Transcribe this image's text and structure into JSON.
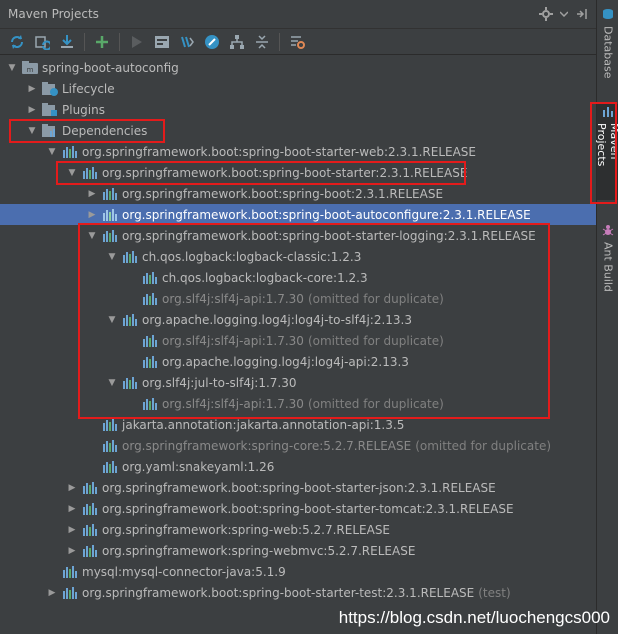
{
  "window": {
    "title": "Maven Projects"
  },
  "side_tabs": [
    {
      "label": "Database",
      "icon": "database-icon"
    },
    {
      "label": "Maven Projects",
      "icon": "maven-icon"
    },
    {
      "label": "Ant Build",
      "icon": "ant-icon"
    }
  ],
  "toolbar": {
    "buttons": [
      "reimport-icon",
      "generate-sources-icon",
      "download-icon",
      "add-icon",
      "run-icon",
      "execute-goal-icon",
      "toggle-offline-icon",
      "skip-tests-icon",
      "show-dependencies-icon",
      "collapse-all-icon",
      "settings-icon"
    ]
  },
  "tree": {
    "root": {
      "label": "spring-boot-autoconfig"
    },
    "lifecycle": {
      "label": "Lifecycle"
    },
    "plugins": {
      "label": "Plugins"
    },
    "dependencies": {
      "label": "Dependencies"
    },
    "starter_web": {
      "label": "org.springframework.boot:spring-boot-starter-web:2.3.1.RELEASE"
    },
    "starter": {
      "label": "org.springframework.boot:spring-boot-starter:2.3.1.RELEASE"
    },
    "spring_boot": {
      "label": "org.springframework.boot:spring-boot:2.3.1.RELEASE"
    },
    "autoconfigure": {
      "label": "org.springframework.boot:spring-boot-autoconfigure:2.3.1.RELEASE"
    },
    "starter_logging": {
      "label": "org.springframework.boot:spring-boot-starter-logging:2.3.1.RELEASE"
    },
    "logback_classic": {
      "label": "ch.qos.logback:logback-classic:1.2.3"
    },
    "logback_core": {
      "label": "ch.qos.logback:logback-core:1.2.3"
    },
    "slf4j_api_1": {
      "label": "org.slf4j:slf4j-api:1.7.30",
      "suffix": "(omitted for duplicate)"
    },
    "log4j_to_slf4j": {
      "label": "org.apache.logging.log4j:log4j-to-slf4j:2.13.3"
    },
    "slf4j_api_2": {
      "label": "org.slf4j:slf4j-api:1.7.30",
      "suffix": "(omitted for duplicate)"
    },
    "log4j_api": {
      "label": "org.apache.logging.log4j:log4j-api:2.13.3"
    },
    "jul_to_slf4j": {
      "label": "org.slf4j:jul-to-slf4j:1.7.30"
    },
    "slf4j_api_3": {
      "label": "org.slf4j:slf4j-api:1.7.30",
      "suffix": "(omitted for duplicate)"
    },
    "jakarta_annotation": {
      "label": "jakarta.annotation:jakarta.annotation-api:1.3.5"
    },
    "spring_core": {
      "label": "org.springframework:spring-core:5.2.7.RELEASE",
      "suffix": "(omitted for duplicate)"
    },
    "snakeyaml": {
      "label": "org.yaml:snakeyaml:1.26"
    },
    "starter_json": {
      "label": "org.springframework.boot:spring-boot-starter-json:2.3.1.RELEASE"
    },
    "starter_tomcat": {
      "label": "org.springframework.boot:spring-boot-starter-tomcat:2.3.1.RELEASE"
    },
    "spring_web": {
      "label": "org.springframework:spring-web:5.2.7.RELEASE"
    },
    "spring_webmvc": {
      "label": "org.springframework:spring-webmvc:5.2.7.RELEASE"
    },
    "mysql_connector": {
      "label": "mysql:mysql-connector-java:5.1.9"
    },
    "starter_test": {
      "label": "org.springframework.boot:spring-boot-starter-test:2.3.1.RELEASE",
      "suffix": "(test)"
    }
  },
  "watermark": "https://blog.csdn.net/luochengcs000",
  "colors": {
    "background": "#3c3f41",
    "selection": "#4b6eaf",
    "annotation": "#e31b1b",
    "dependency_icon": "#6da5d4"
  }
}
